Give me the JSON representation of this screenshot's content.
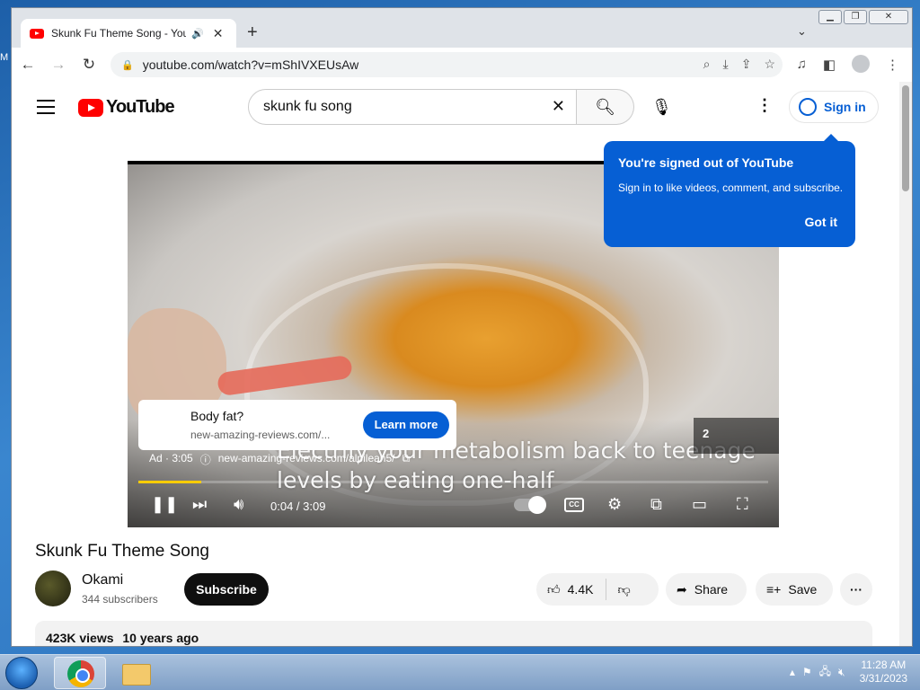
{
  "browser": {
    "tab_title": "Skunk Fu Theme Song - YouTube",
    "new_tab": "+",
    "url": "youtube.com/watch?v=mShIVXEUsAw"
  },
  "youtube": {
    "logo_text": "YouTube",
    "search_value": "skunk fu song",
    "sign_in": "Sign in",
    "tooltip": {
      "title": "You're signed out of YouTube",
      "body": "Sign in to like videos, comment, and subscribe.",
      "button": "Got it"
    },
    "player": {
      "caption": "Electrify your metabolism back to teenage levels by eating one-half",
      "ad": {
        "title": "Body fat?",
        "url": "new-amazing-reviews.com/...",
        "cta": "Learn more",
        "label": "Ad · 3:05",
        "display_url": "new-amazing-reviews.com/alpilean5/",
        "skip_countdown": "2"
      },
      "time": "0:04 / 3:09",
      "progress": 0.1
    },
    "video": {
      "title": "Skunk Fu Theme Song",
      "channel": "Okami",
      "subscribers": "344 subscribers",
      "subscribe": "Subscribe",
      "likes": "4.4K",
      "share": "Share",
      "save": "Save",
      "views": "423K views",
      "age": "10 years ago"
    }
  },
  "taskbar": {
    "time": "11:28 AM",
    "date": "3/31/2023"
  },
  "colors": {
    "yt_red": "#ff0000",
    "yt_blue": "#065fd4",
    "ad_progress": "#ffcc00"
  }
}
